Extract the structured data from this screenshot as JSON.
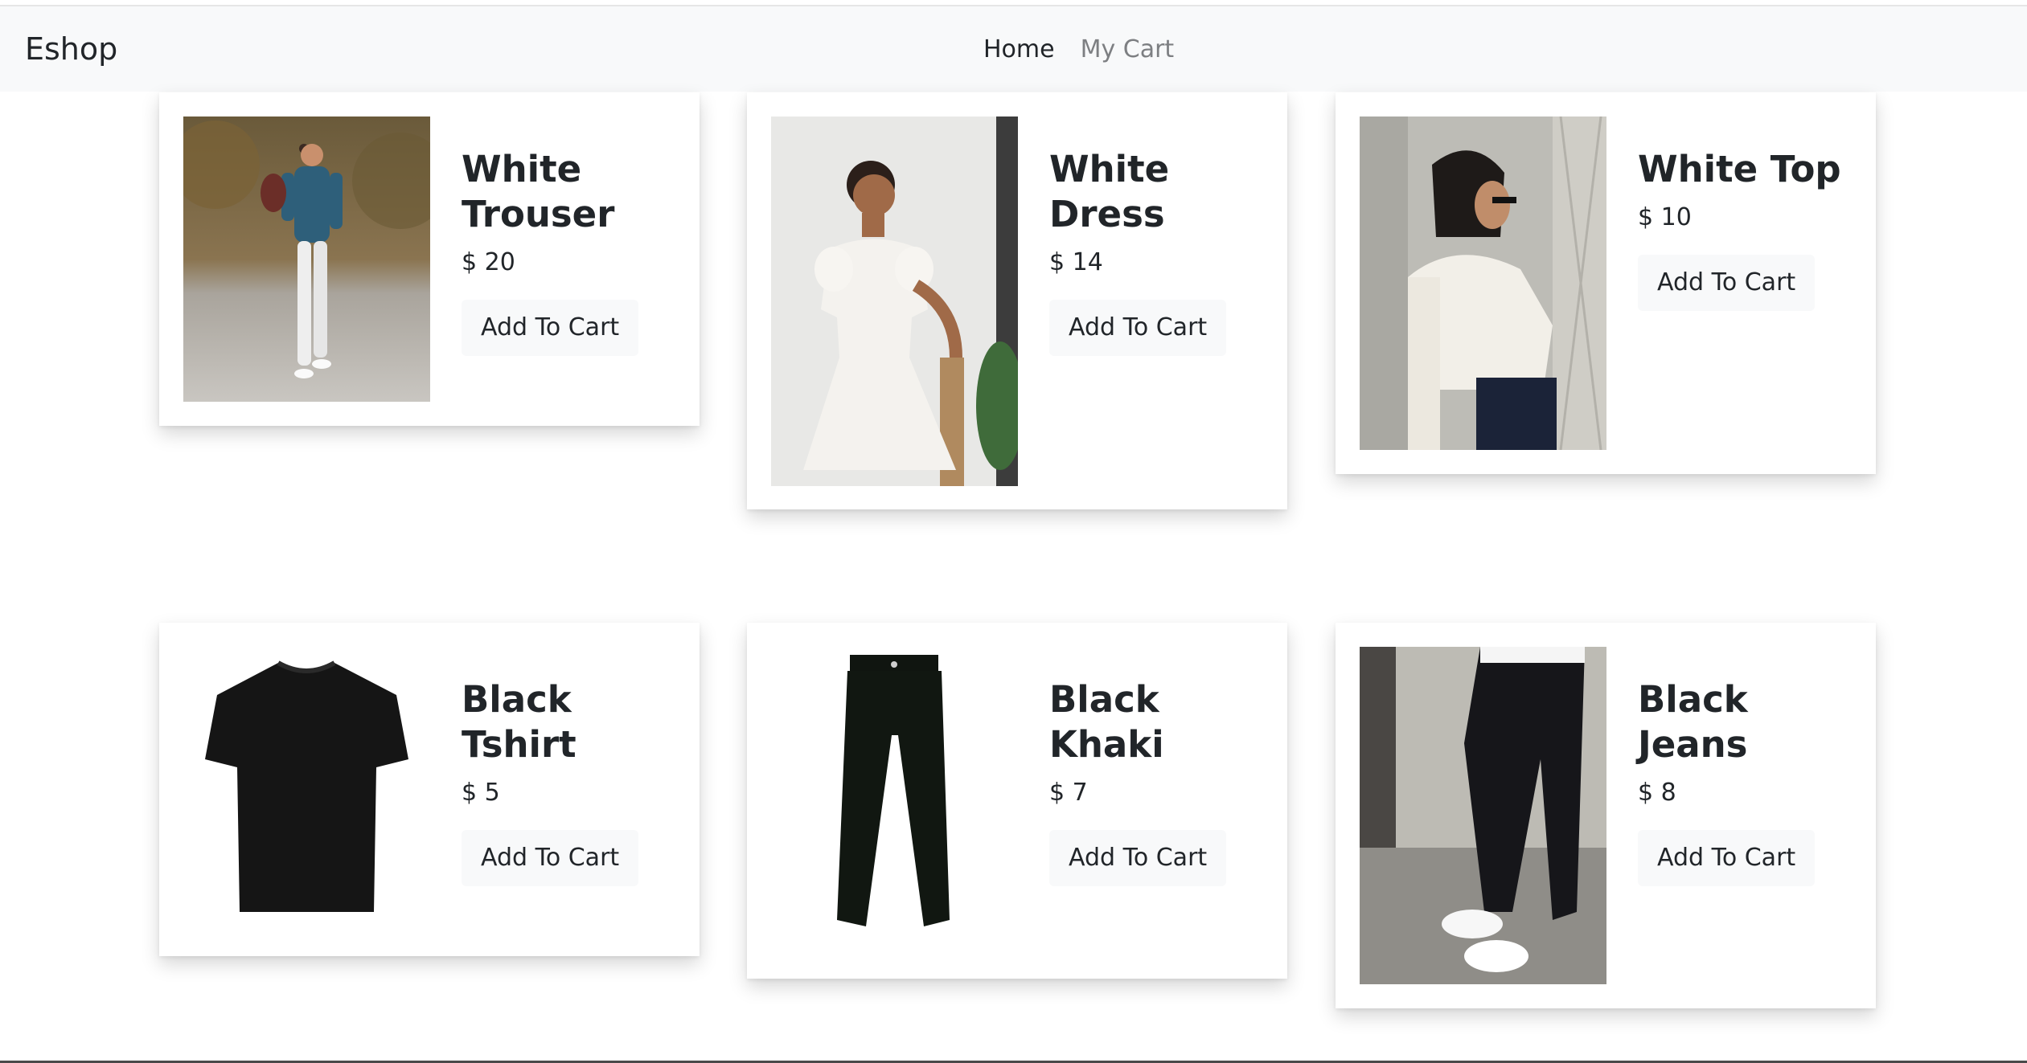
{
  "navbar": {
    "brand": "Eshop",
    "links": [
      {
        "label": "Home"
      },
      {
        "label": "My Cart"
      }
    ]
  },
  "products": [
    {
      "title": "White Trouser",
      "price": "$ 20",
      "button": "Add To Cart",
      "image": "man-white-trousers-photo"
    },
    {
      "title": "White Dress",
      "price": "$ 14",
      "button": "Add To Cart",
      "image": "woman-white-dress-photo"
    },
    {
      "title": "White Top",
      "price": "$ 10",
      "button": "Add To Cart",
      "image": "woman-white-top-photo"
    },
    {
      "title": "Black Tshirt",
      "price": "$ 5",
      "button": "Add To Cart",
      "image": "black-tshirt-photo"
    },
    {
      "title": "Black Khaki",
      "price": "$ 7",
      "button": "Add To Cart",
      "image": "black-khaki-pants-photo"
    },
    {
      "title": "Black Jeans",
      "price": "$ 8",
      "button": "Add To Cart",
      "image": "black-jeans-photo"
    }
  ],
  "colors": {
    "navbar_bg": "#f8f9fa",
    "text": "#212529",
    "muted_link": "#7d7f82",
    "button_bg": "#f8f9fa"
  }
}
